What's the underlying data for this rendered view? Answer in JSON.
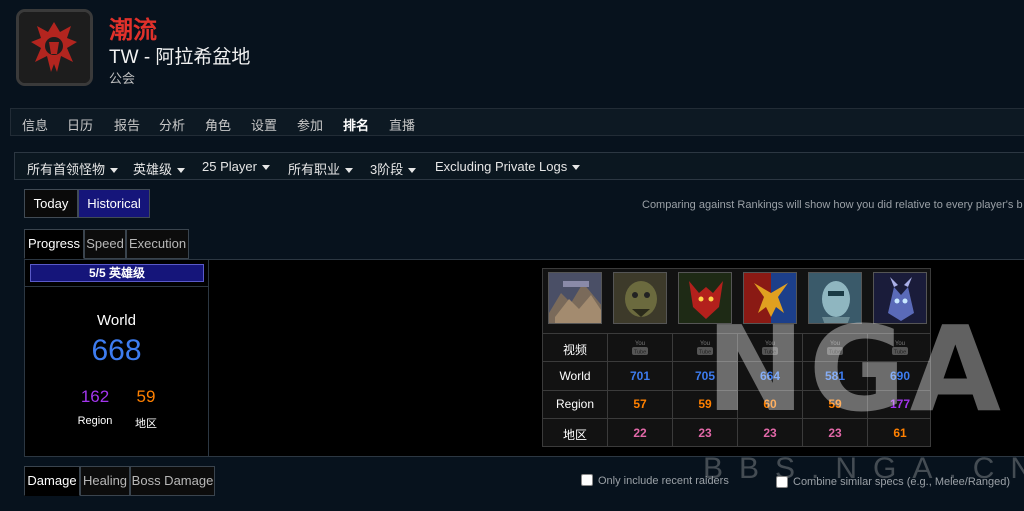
{
  "guild": {
    "name": "潮流",
    "realm": "TW - 阿拉希盆地",
    "type": "公会",
    "logo_icon": "horde-crest-icon"
  },
  "nav": {
    "items": [
      "信息",
      "日历",
      "报告",
      "分析",
      "角色",
      "设置",
      "参加",
      "排名",
      "直播"
    ],
    "active": "排名"
  },
  "filters": [
    "所有首领怪物",
    "英雄级",
    "25 Player",
    "所有职业",
    "3阶段",
    "Excluding Private Logs"
  ],
  "toggle": {
    "today": "Today",
    "historical": "Historical",
    "active": "Historical"
  },
  "compare_note": "Comparing against Rankings will show how you did relative to every player's b",
  "tabs_top": {
    "items": [
      "Progress",
      "Speed",
      "Execution"
    ],
    "active": "Progress"
  },
  "progress": {
    "difficulty": "5/5 英雄级",
    "world_label": "World",
    "world_rank": "668",
    "region_rank": "162",
    "local_rank": "59",
    "region_label": "Region",
    "local_label": "地区"
  },
  "boss_table": {
    "row_labels": [
      "视频",
      "World",
      "Region",
      "地区"
    ],
    "video_icon": "youtube-icon",
    "bosses": [
      {
        "icon": "boss-1-portrait",
        "world": "701",
        "region": "57",
        "local": "22"
      },
      {
        "icon": "boss-2-portrait",
        "world": "705",
        "region": "59",
        "local": "23"
      },
      {
        "icon": "boss-3-portrait",
        "world": "664",
        "region": "60",
        "local": "23"
      },
      {
        "icon": "boss-4-portrait",
        "world": "581",
        "region": "59",
        "local": "23"
      },
      {
        "icon": "boss-5-portrait",
        "world": "690",
        "region": "177",
        "local": "61"
      }
    ],
    "colors": {
      "world": "#3d7cf0",
      "region_orange": "#ff8000",
      "region_purple": "#a335ee",
      "local_pink": "#e268a8",
      "local_orange": "#ff8000"
    }
  },
  "tabs_bottom": {
    "items": [
      "Damage",
      "Healing",
      "Boss Damage"
    ],
    "active": "Damage"
  },
  "options": {
    "recent_raiders": "Only include recent raiders",
    "combine_specs": "Combine similar specs (e.g., Melee/Ranged)"
  },
  "watermark": {
    "big": "NGA",
    "small": "BBS.NGA.CN"
  }
}
